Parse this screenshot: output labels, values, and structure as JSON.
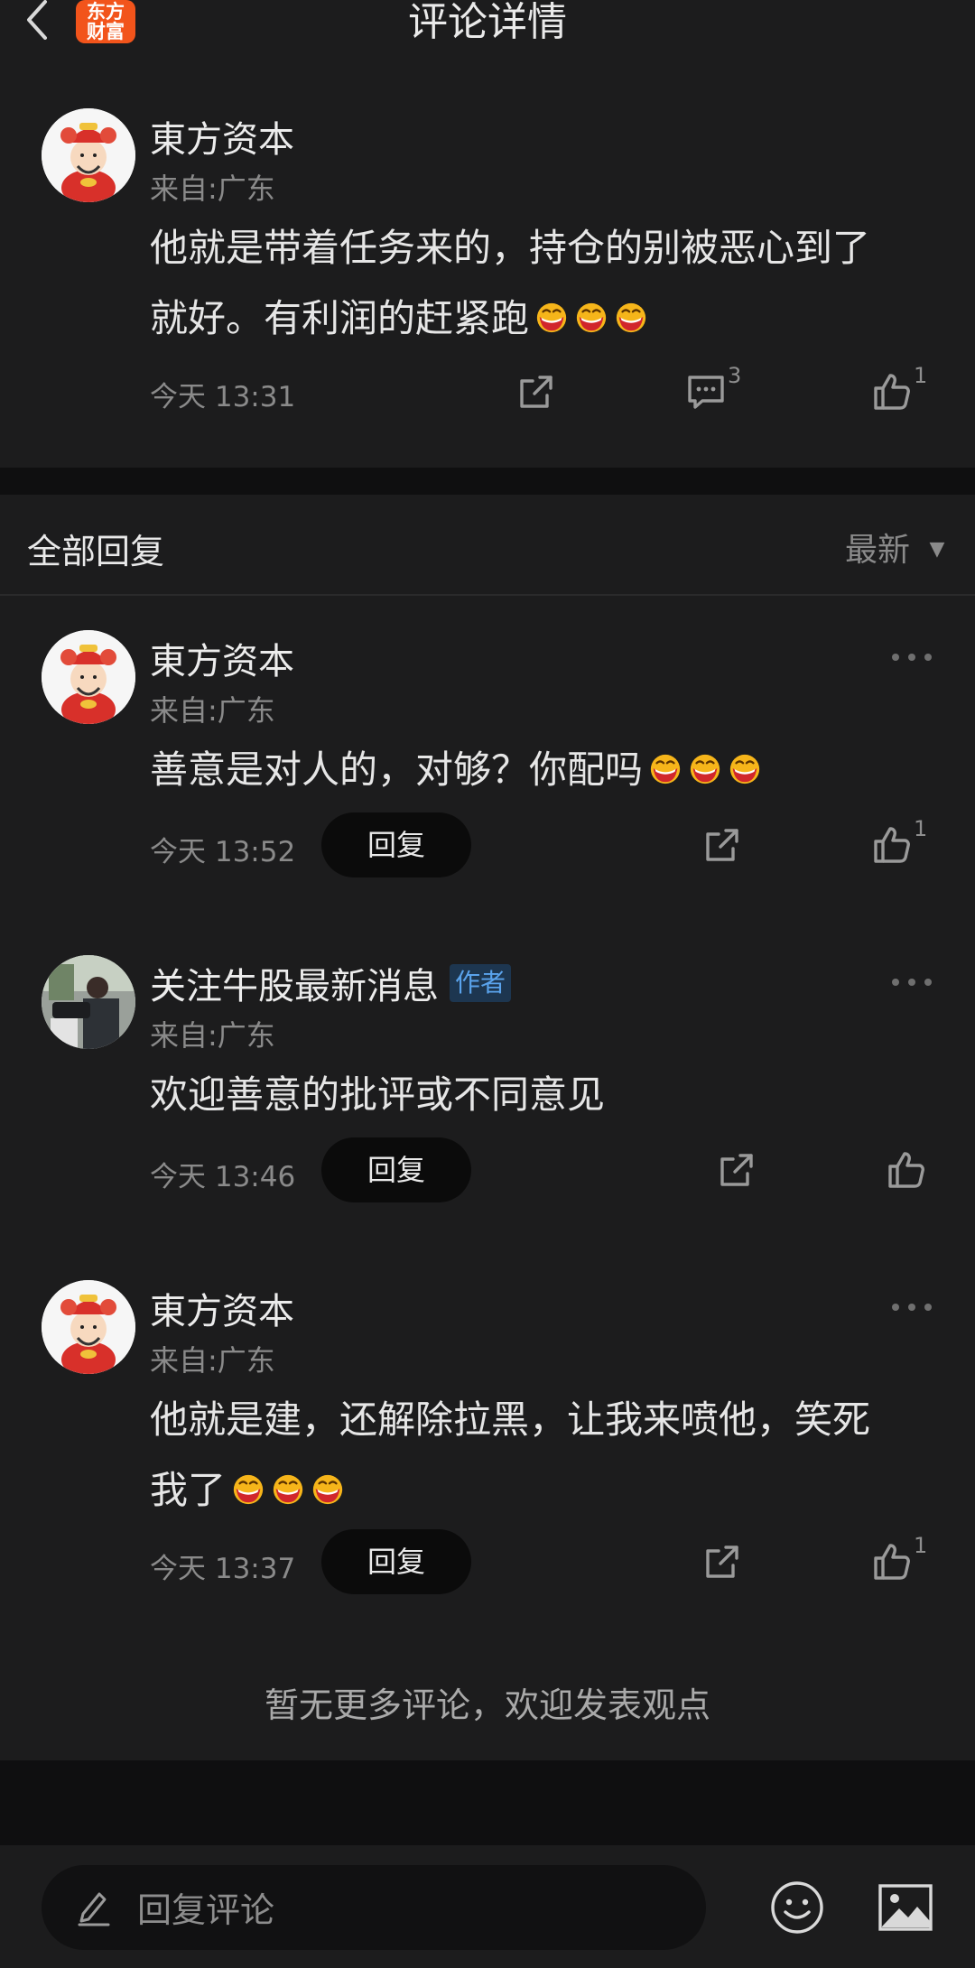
{
  "header": {
    "title": "评论详情",
    "logo_line1": "东方",
    "logo_line2": "财富"
  },
  "main_comment": {
    "user": "東方资本",
    "location": "来自:广东",
    "text_line1": "他就是带着任务来的，持仓的别被恶心到了",
    "text_line2": "就好。有利润的赶紧跑",
    "time": "今天 13:31",
    "comment_count": "3",
    "like_count": "1"
  },
  "replies_section": {
    "title": "全部回复",
    "sort_label": "最新"
  },
  "replies": [
    {
      "user": "東方资本",
      "location": "来自:广东",
      "text_line1": "善意是对人的，对够？你配吗",
      "time": "今天 13:52",
      "reply_label": "回复",
      "like_count": "1"
    },
    {
      "user": "关注牛股最新消息",
      "badge": "作者",
      "location": "来自:广东",
      "text_line1": "欢迎善意的批评或不同意见",
      "time": "今天 13:46",
      "reply_label": "回复",
      "like_count": ""
    },
    {
      "user": "東方资本",
      "location": "来自:广东",
      "text_line1": "他就是建，还解除拉黑，让我来喷他，笑死",
      "text_line2": "我了",
      "time": "今天 13:37",
      "reply_label": "回复",
      "like_count": "1"
    }
  ],
  "footer_note": "暂无更多评论，欢迎发表观点",
  "bottom_bar": {
    "input_placeholder": "回复评论"
  },
  "colors": {
    "background": "#0f0f10",
    "card": "#1c1c1d",
    "accent": "#f2541b",
    "author_badge": "#5aa3ec"
  },
  "icons": [
    "back-icon",
    "share-icon",
    "comment-icon",
    "like-icon",
    "more-icon",
    "pencil-icon",
    "emoji-icon",
    "image-icon"
  ]
}
